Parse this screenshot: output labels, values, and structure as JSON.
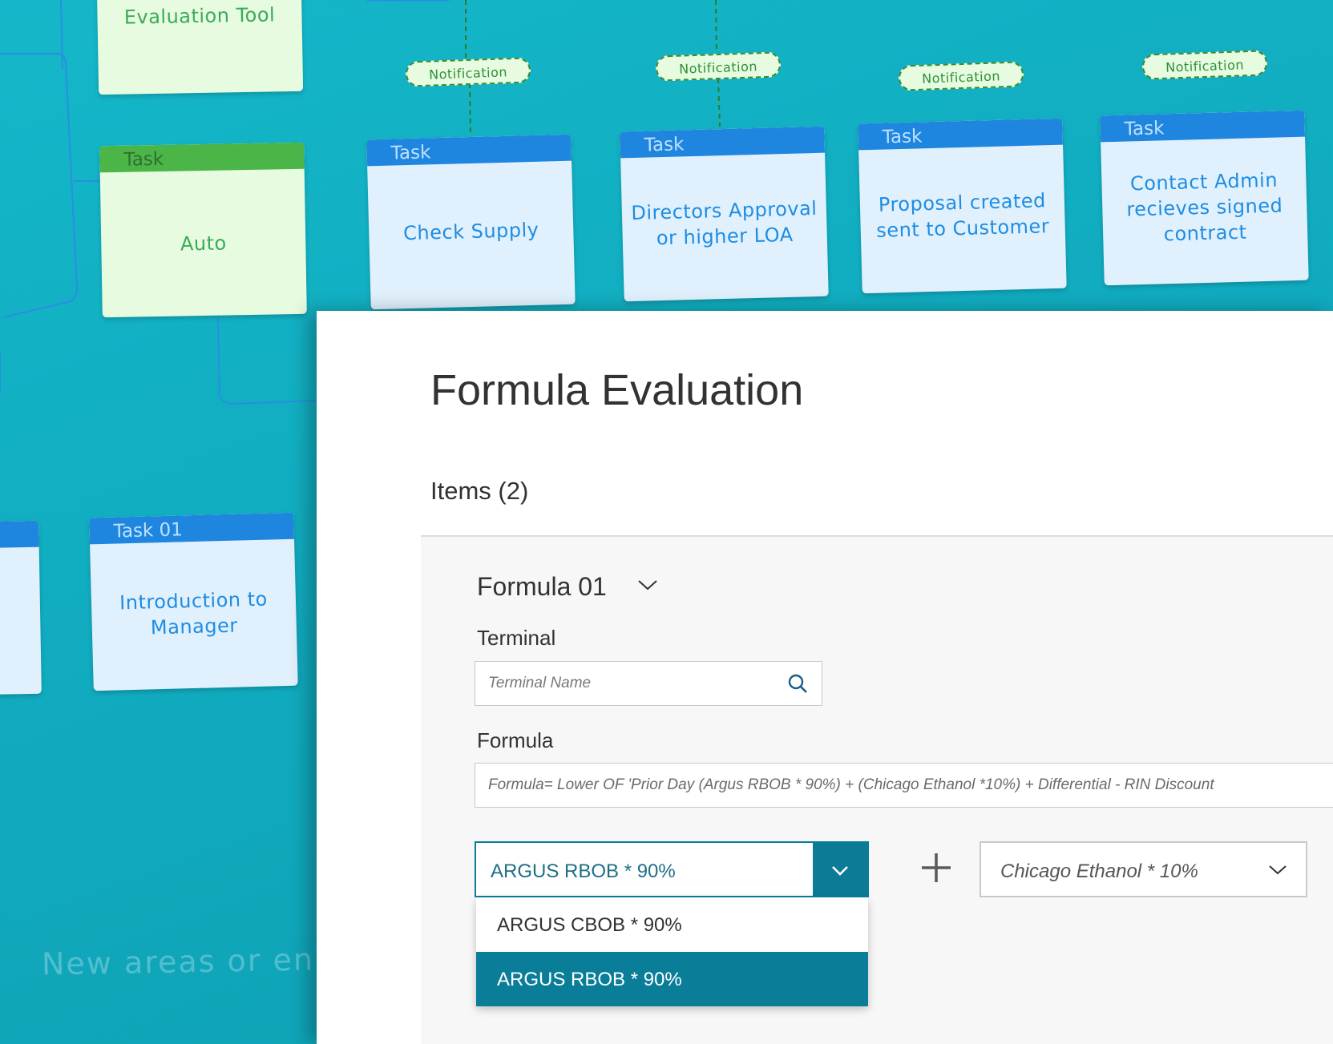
{
  "diagram": {
    "top_left_card": {
      "body": "Evaluation Tool"
    },
    "auto_card": {
      "header": "Task",
      "body": "Auto"
    },
    "tasks": [
      {
        "header": "Task",
        "body": "Check Supply",
        "notification": "Notification"
      },
      {
        "header": "Task",
        "body": "Directors Approval or higher LOA",
        "notification": "Notification"
      },
      {
        "header": "Task",
        "body": "Proposal created sent to Customer",
        "notification": "Notification"
      },
      {
        "header": "Task",
        "body": "Contact Admin recieves signed contract",
        "notification": "Notification"
      }
    ],
    "task01": {
      "header": "Task 01",
      "body": "Introduction to Manager"
    },
    "hint_text": "New areas or enha"
  },
  "panel": {
    "title": "Formula Evaluation",
    "items_label": "Items (2)",
    "formula_name": "Formula 01",
    "terminal_label": "Terminal",
    "terminal_placeholder": "Terminal Name",
    "formula_label": "Formula",
    "formula_value": "Formula= Lower OF 'Prior Day (Argus RBOB * 90%) + (Chicago Ethanol *10%) + Differential - RIN Discount",
    "select1_value": "ARGUS RBOB * 90%",
    "select2_value": "Chicago Ethanol * 10%",
    "dropdown_options": [
      "ARGUS CBOB * 90%",
      "ARGUS RBOB * 90%"
    ],
    "selected_option": "ARGUS RBOB * 90%"
  },
  "colors": {
    "background": "#12b0c4",
    "task_header": "#1f86e0",
    "auto_header": "#4bb548",
    "accent": "#0c7b96"
  },
  "icons": [
    "search-icon",
    "chevron-down-icon",
    "plus-icon"
  ]
}
